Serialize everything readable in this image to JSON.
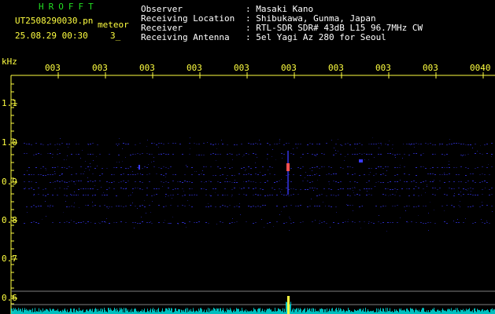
{
  "header": {
    "brand": "HROFFT",
    "filename": "UT2508290030.pn",
    "filename_tag": "meteor",
    "datetime": "25.08.29 00:30",
    "count_label": "3_",
    "fields": [
      {
        "label": "Observer",
        "value": ": Masaki Kano"
      },
      {
        "label": "Receiving Location",
        "value": ": Shibukawa, Gunma, Japan"
      },
      {
        "label": "Receiver",
        "value": ": RTL-SDR SDR# 43dB L15 96.7MHz CW"
      },
      {
        "label": "Receiving Antenna",
        "value": ": 5el Yagi Az 280 for Seoul"
      }
    ]
  },
  "axes": {
    "y_unit": "kHz",
    "y_ticks": [
      "1.1",
      "1.0",
      "0.9",
      "0.8",
      "0.7",
      "0.6"
    ],
    "x_ticks": [
      "003",
      "003",
      "003",
      "003",
      "003",
      "003",
      "003",
      "003",
      "003",
      "0040"
    ]
  },
  "colors": {
    "background": "#000000",
    "axis": "#ffff40",
    "grid": "#808080",
    "signal": "#3a3aff",
    "meteor": "#ff5050",
    "spectrum": "#00e0e0"
  }
}
